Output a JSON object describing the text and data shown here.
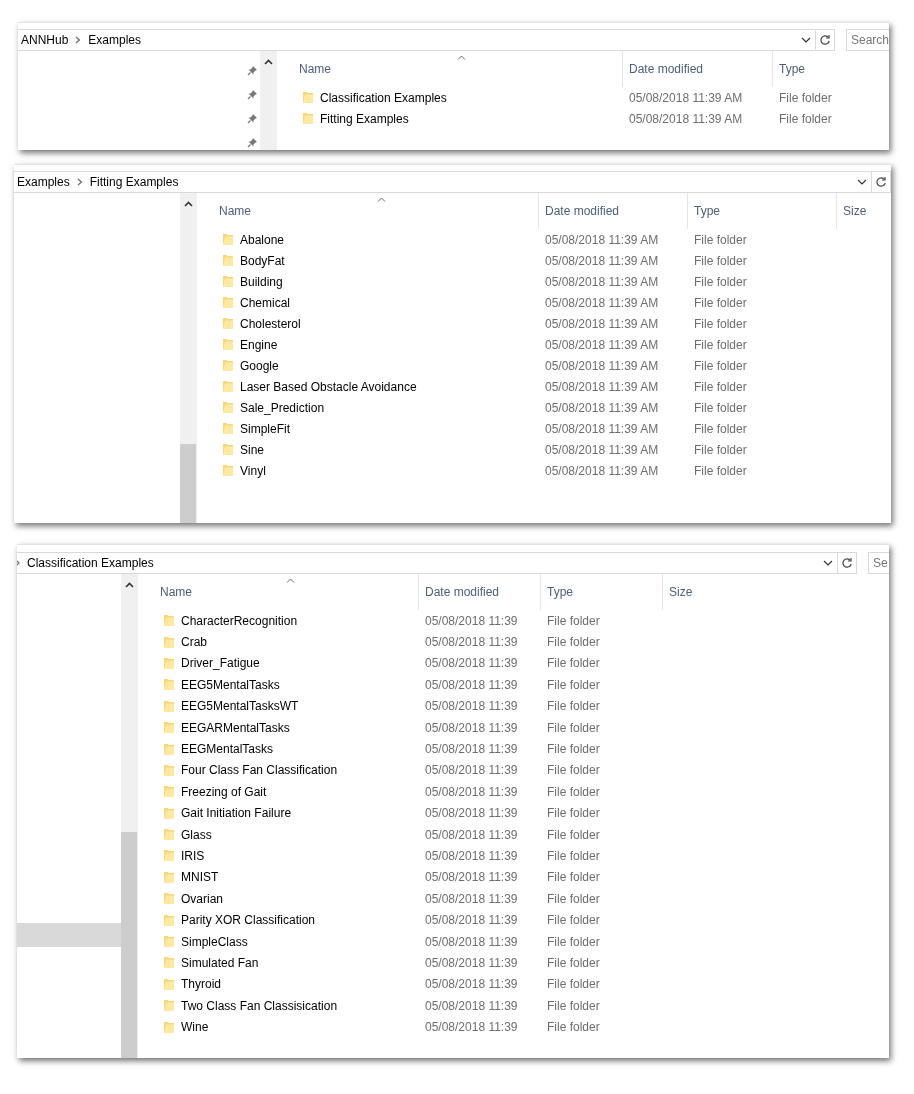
{
  "windows": [
    {
      "breadcrumb": [
        "ANNHub",
        "Examples"
      ],
      "search": {
        "placeholder": "Search"
      },
      "quick_access": [
        {
          "pinned": true
        },
        {
          "pinned": true
        },
        {
          "pinned": true
        },
        {
          "pinned": true
        }
      ],
      "columns": [
        "Name",
        "Date modified",
        "Type"
      ],
      "rows": [
        {
          "name": "Classification Examples",
          "date": "05/08/2018 11:39 AM",
          "type": "File folder"
        },
        {
          "name": "Fitting Examples",
          "date": "05/08/2018 11:39 AM",
          "type": "File folder"
        }
      ]
    },
    {
      "breadcrumb": [
        "Examples",
        "Fitting Examples"
      ],
      "columns": [
        "Name",
        "Date modified",
        "Type",
        "Size"
      ],
      "rows": [
        {
          "name": "Abalone",
          "date": "05/08/2018 11:39 AM",
          "type": "File folder"
        },
        {
          "name": "BodyFat",
          "date": "05/08/2018 11:39 AM",
          "type": "File folder"
        },
        {
          "name": "Building",
          "date": "05/08/2018 11:39 AM",
          "type": "File folder"
        },
        {
          "name": "Chemical",
          "date": "05/08/2018 11:39 AM",
          "type": "File folder"
        },
        {
          "name": "Cholesterol",
          "date": "05/08/2018 11:39 AM",
          "type": "File folder"
        },
        {
          "name": "Engine",
          "date": "05/08/2018 11:39 AM",
          "type": "File folder"
        },
        {
          "name": "Google",
          "date": "05/08/2018 11:39 AM",
          "type": "File folder"
        },
        {
          "name": "Laser Based Obstacle Avoidance",
          "date": "05/08/2018 11:39 AM",
          "type": "File folder"
        },
        {
          "name": "Sale_Prediction",
          "date": "05/08/2018 11:39 AM",
          "type": "File folder"
        },
        {
          "name": "SimpleFit",
          "date": "05/08/2018 11:39 AM",
          "type": "File folder"
        },
        {
          "name": "Sine",
          "date": "05/08/2018 11:39 AM",
          "type": "File folder"
        },
        {
          "name": "Vinyl",
          "date": "05/08/2018 11:39 AM",
          "type": "File folder"
        }
      ]
    },
    {
      "breadcrumb": [
        "Classification Examples"
      ],
      "leading_separator": true,
      "search": {
        "placeholder": "Se"
      },
      "nav_selection": true,
      "columns": [
        "Name",
        "Date modified",
        "Type",
        "Size"
      ],
      "rows": [
        {
          "name": "CharacterRecognition",
          "date": "05/08/2018 11:39",
          "type": "File folder"
        },
        {
          "name": "Crab",
          "date": "05/08/2018 11:39",
          "type": "File folder"
        },
        {
          "name": "Driver_Fatigue",
          "date": "05/08/2018 11:39",
          "type": "File folder"
        },
        {
          "name": "EEG5MentalTasks",
          "date": "05/08/2018 11:39",
          "type": "File folder"
        },
        {
          "name": "EEG5MentalTasksWT",
          "date": "05/08/2018 11:39",
          "type": "File folder"
        },
        {
          "name": "EEGARMentalTasks",
          "date": "05/08/2018 11:39",
          "type": "File folder"
        },
        {
          "name": "EEGMentalTasks",
          "date": "05/08/2018 11:39",
          "type": "File folder"
        },
        {
          "name": "Four Class Fan Classification",
          "date": "05/08/2018 11:39",
          "type": "File folder"
        },
        {
          "name": "Freezing of Gait",
          "date": "05/08/2018 11:39",
          "type": "File folder"
        },
        {
          "name": "Gait Initiation Failure",
          "date": "05/08/2018 11:39",
          "type": "File folder"
        },
        {
          "name": "Glass",
          "date": "05/08/2018 11:39",
          "type": "File folder"
        },
        {
          "name": "IRIS",
          "date": "05/08/2018 11:39",
          "type": "File folder"
        },
        {
          "name": "MNIST",
          "date": "05/08/2018 11:39",
          "type": "File folder"
        },
        {
          "name": "Ovarian",
          "date": "05/08/2018 11:39",
          "type": "File folder"
        },
        {
          "name": "Parity XOR Classification",
          "date": "05/08/2018 11:39",
          "type": "File folder"
        },
        {
          "name": "SimpleClass",
          "date": "05/08/2018 11:39",
          "type": "File folder"
        },
        {
          "name": "Simulated Fan",
          "date": "05/08/2018 11:39",
          "type": "File folder"
        },
        {
          "name": "Thyroid",
          "date": "05/08/2018 11:39",
          "type": "File folder"
        },
        {
          "name": "Two Class Fan Classisication",
          "date": "05/08/2018 11:39",
          "type": "File folder"
        },
        {
          "name": "Wine",
          "date": "05/08/2018 11:39",
          "type": "File folder"
        }
      ]
    }
  ]
}
